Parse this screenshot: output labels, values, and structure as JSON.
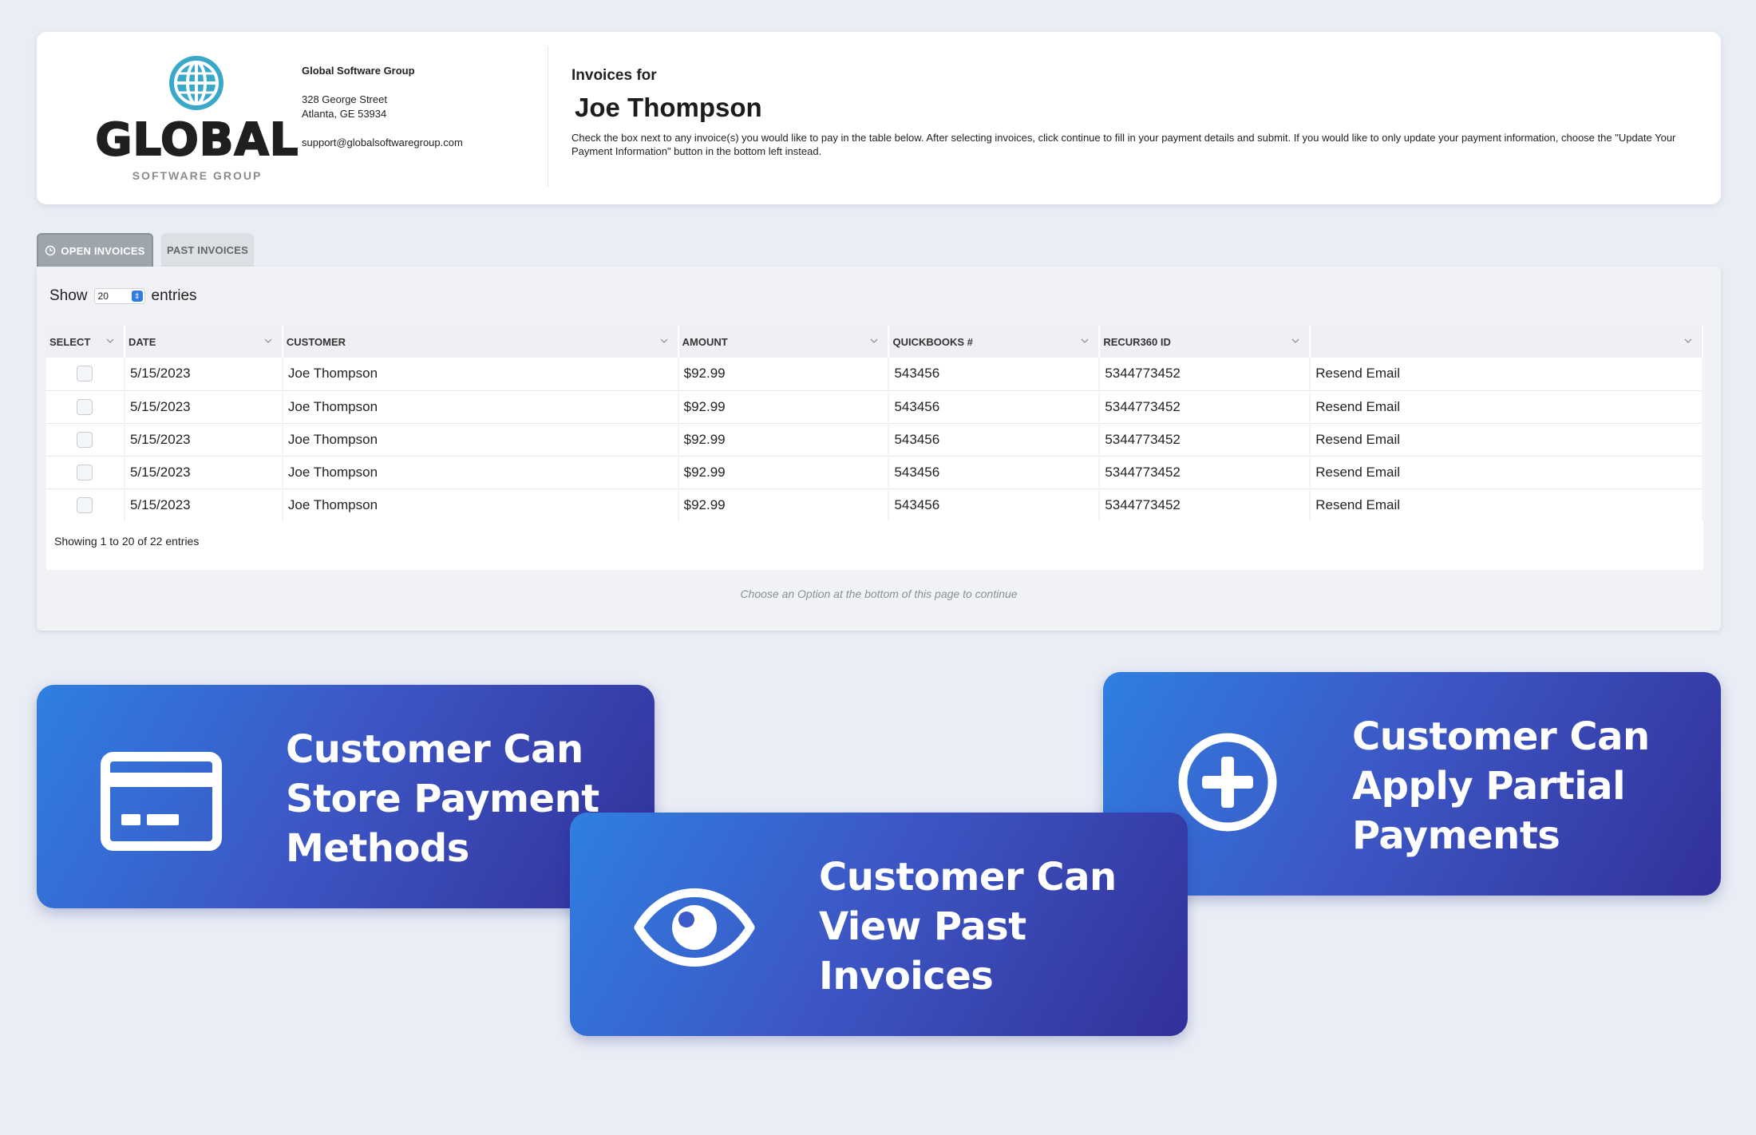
{
  "company": {
    "logo_word": "GLOBAL",
    "logo_sub": "SOFTWARE GROUP",
    "name": "Global Software Group",
    "address_line1": "328 George Street",
    "address_line2": "Atlanta, GE 53934",
    "email": "support@globalsoftwaregroup.com"
  },
  "invoice_header": {
    "label": "Invoices for",
    "customer": "Joe Thompson",
    "instructions": "Check the box next to any invoice(s) you would like to pay in the table below. After selecting invoices, click continue to fill in your payment details and submit. If you would like to only update your payment information, choose the \"Update Your Payment Information\" button in the bottom left instead."
  },
  "tabs": [
    {
      "label": "Open Invoices",
      "icon": "clock-icon",
      "active": true
    },
    {
      "label": "Past Invoices",
      "active": false
    }
  ],
  "table": {
    "show_label": "Show",
    "entries_value": "20",
    "entries_label": "entries",
    "columns": [
      "Select",
      "Date",
      "Customer",
      "Amount",
      "QuickBooks #",
      "Recur360 ID",
      ""
    ],
    "rows": [
      {
        "date": "5/15/2023",
        "customer": "Joe Thompson",
        "amount": "$92.99",
        "quickbooks": "543456",
        "recur_id": "5344773452",
        "action": "Resend Email"
      },
      {
        "date": "5/15/2023",
        "customer": "Joe Thompson",
        "amount": "$92.99",
        "quickbooks": "543456",
        "recur_id": "5344773452",
        "action": "Resend Email"
      },
      {
        "date": "5/15/2023",
        "customer": "Joe Thompson",
        "amount": "$92.99",
        "quickbooks": "543456",
        "recur_id": "5344773452",
        "action": "Resend Email"
      },
      {
        "date": "5/15/2023",
        "customer": "Joe Thompson",
        "amount": "$92.99",
        "quickbooks": "543456",
        "recur_id": "5344773452",
        "action": "Resend Email"
      },
      {
        "date": "5/15/2023",
        "customer": "Joe Thompson",
        "amount": "$92.99",
        "quickbooks": "543456",
        "recur_id": "5344773452",
        "action": "Resend Email"
      }
    ],
    "showing": "Showing 1 to 20 of 22 entries",
    "hint": "Choose an Option at the bottom of this page to continue"
  },
  "features": [
    {
      "title": "Customer Can Store Payment Methods",
      "icon": "credit-card-icon"
    },
    {
      "title": "Customer Can Apply Partial Payments",
      "icon": "plus-circle-icon"
    },
    {
      "title": "Customer Can View Past Invoices",
      "icon": "eye-icon"
    }
  ],
  "colors": {
    "page_bg": "#e9edf5",
    "feature_gradient_start": "#2f7fe0",
    "feature_gradient_end": "#33309a",
    "logo_globe": "#3aa8c8"
  }
}
